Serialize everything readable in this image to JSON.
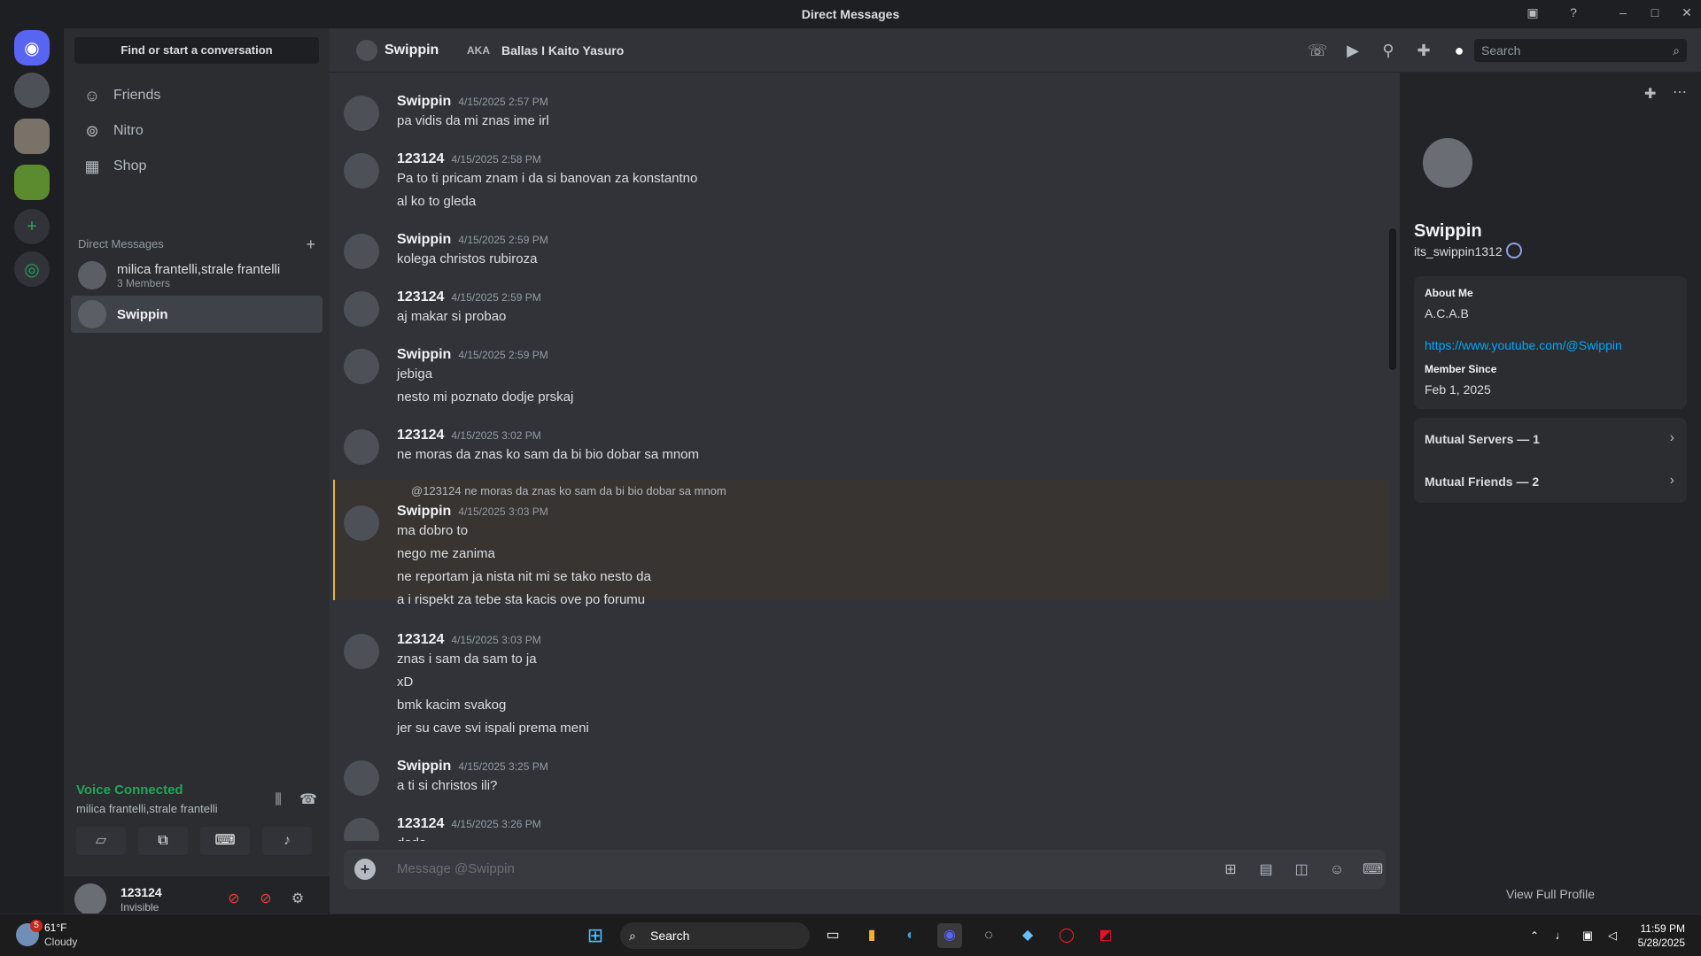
{
  "window": {
    "title": "Direct Messages"
  },
  "sidebar": {
    "find_placeholder": "Find or start a conversation",
    "nav": [
      {
        "label": "Friends"
      },
      {
        "label": "Nitro"
      },
      {
        "label": "Shop"
      }
    ],
    "dm_header": "Direct Messages",
    "dms": [
      {
        "name": "milica frantelli,strale frantelli",
        "sub": "3 Members"
      },
      {
        "name": "Swippin",
        "sub": ""
      }
    ]
  },
  "voice": {
    "status": "Voice Connected",
    "channel": "milica frantelli,strale frantelli"
  },
  "user": {
    "name": "123124",
    "status": "Invisible"
  },
  "chat_header": {
    "name": "Swippin",
    "aka": "AKA",
    "aka_name": "Ballas I Kaito Yasuro",
    "search_placeholder": "Search"
  },
  "messages": [
    {
      "author": "Swippin",
      "time": "4/15/2025 2:57 PM",
      "lines": [
        "pa vidis da mi znas ime irl"
      ]
    },
    {
      "author": "123124",
      "time": "4/15/2025 2:58 PM",
      "lines": [
        "Pa to ti pricam znam i da si banovan za konstantno",
        "al ko to gleda"
      ]
    },
    {
      "author": "Swippin",
      "time": "4/15/2025 2:59 PM",
      "lines": [
        "kolega christos rubiroza"
      ]
    },
    {
      "author": "123124",
      "time": "4/15/2025 2:59 PM",
      "lines": [
        "aj makar si probao"
      ]
    },
    {
      "author": "Swippin",
      "time": "4/15/2025 2:59 PM",
      "lines": [
        "jebiga",
        "nesto mi poznato dodje prskaj"
      ]
    },
    {
      "author": "123124",
      "time": "4/15/2025 3:02 PM",
      "lines": [
        "ne moras da znas ko sam da bi bio dobar sa mnom"
      ]
    },
    {
      "author": "Swippin",
      "time": "4/15/2025 3:03 PM",
      "reply_to": "@123124",
      "reply_text": "ne moras da znas ko sam da bi bio dobar sa mnom",
      "lines": [
        "ma dobro to",
        "nego me zanima",
        "ne reportam ja nista nit mi se tako nesto da",
        "a i rispekt za tebe sta kacis ove po forumu"
      ]
    },
    {
      "author": "123124",
      "time": "4/15/2025 3:03 PM",
      "lines": [
        "znas i sam da sam to ja",
        "xD",
        "bmk kacim svakog",
        "jer su cave svi ispali prema meni"
      ]
    },
    {
      "author": "Swippin",
      "time": "4/15/2025 3:25 PM",
      "lines": [
        "a ti si christos ili?"
      ]
    },
    {
      "author": "123124",
      "time": "4/15/2025 3:26 PM",
      "lines": [
        "dada"
      ]
    }
  ],
  "composer": {
    "placeholder": "Message @Swippin"
  },
  "profile": {
    "name": "Swippin",
    "username": "its_swippin1312",
    "about_label": "About Me",
    "about": "A.C.A.B",
    "link": "https://www.youtube.com/@Swippin",
    "member_since_label": "Member Since",
    "member_since": "Feb 1, 2025",
    "mutual_servers": "Mutual Servers — 1",
    "mutual_friends": "Mutual Friends — 2",
    "view_full": "View Full Profile"
  },
  "taskbar": {
    "weather_temp": "61°F",
    "weather_desc": "Cloudy",
    "weather_badge": "5",
    "search": "Search",
    "time": "11:59 PM",
    "date": "5/28/2025"
  },
  "colors": {
    "accent": "#5865f2",
    "online": "#23a55a",
    "link": "#00a8fc",
    "highlight_bar": "#f0b232"
  }
}
